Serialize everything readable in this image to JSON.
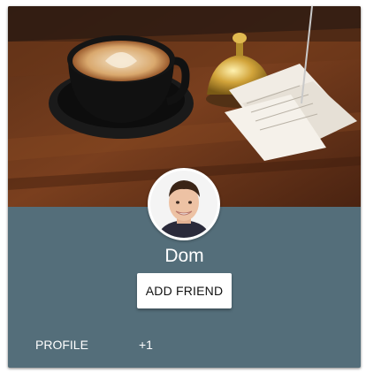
{
  "profile_card": {
    "cover_image": "coffee-cup-with-latte-art-and-bell-on-wooden-table",
    "avatar_image": "smiling-young-man-portrait",
    "name": "Dom",
    "add_friend_label": "ADD FRIEND",
    "actions": [
      {
        "label": "PROFILE"
      },
      {
        "label": "+1"
      }
    ]
  },
  "colors": {
    "card_background": "#546e7a",
    "button_background": "#ffffff",
    "text_on_card": "#ffffff"
  }
}
